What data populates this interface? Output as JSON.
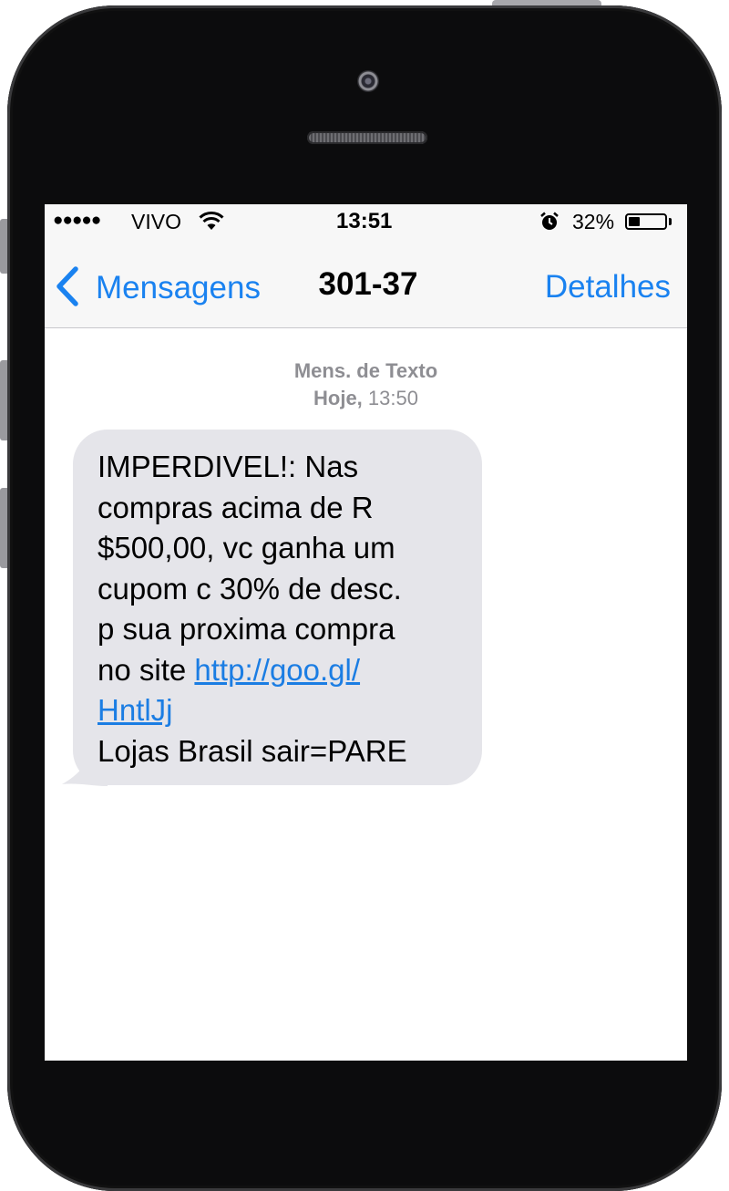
{
  "status_bar": {
    "signal": "●●●●●",
    "carrier": "VIVO",
    "time": "13:51",
    "battery_percent": "32%",
    "battery_level": 0.32
  },
  "nav": {
    "back_label": "Mensagens",
    "title": "301-37",
    "details_label": "Detalhes"
  },
  "message": {
    "type_label": "Mens. de Texto",
    "day_label": "Hoje,",
    "time_label": "13:50",
    "lines": [
      "IMPERDIVEL!: Nas",
      "compras acima de R",
      "$500,00, vc ganha um",
      "cupom c 30% de desc.",
      "p sua proxima compra",
      "no site "
    ],
    "link_part1": "http://goo.gl/",
    "link_part2": "HntlJj",
    "last_line": "Lojas Brasil sair=PARE"
  },
  "colors": {
    "accent": "#1a82f0",
    "bubble": "#e5e5ea",
    "meta": "#8e8e93"
  },
  "icons": [
    "wifi-icon",
    "alarm-icon",
    "battery-icon",
    "back-chevron-icon",
    "front-camera",
    "earpiece-speaker"
  ]
}
